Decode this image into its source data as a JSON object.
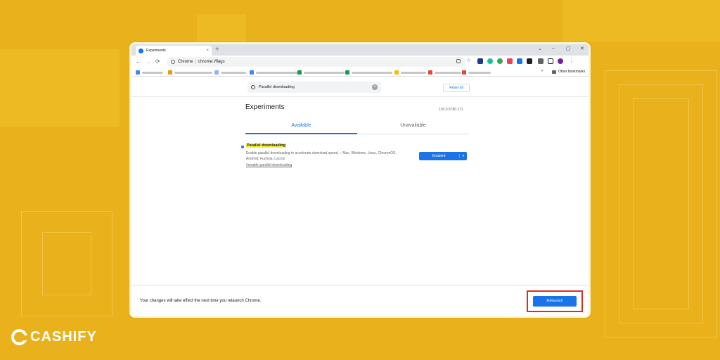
{
  "browser": {
    "tab_title": "Experiments",
    "tab_close": "×",
    "new_tab": "+",
    "window_controls": [
      "⌄",
      "–",
      "▢",
      "✕"
    ],
    "nav": [
      "←",
      "→",
      "⟳"
    ],
    "omnibox_site": "Chrome",
    "omnibox_sep": "|",
    "omnibox_url": "chrome://flags",
    "other_bookmarks": "Other bookmarks",
    "bookmarks_chevron": "»",
    "toolbar_icons": [
      "share-icon",
      "star-icon",
      "extension-icon",
      "grammarly-icon",
      "extension-icon",
      "pocket-icon",
      "extension-icon",
      "extension-icon",
      "puzzle-icon",
      "sidepanel-icon",
      "profile-icon",
      "menu-icon"
    ]
  },
  "flags_page": {
    "search_value": "Parallel downloading",
    "clear": "×",
    "reset_all": "Reset all",
    "title": "Experiments",
    "version": "135.0.5790.171",
    "tabs": [
      "Available",
      "Unavailable"
    ],
    "flag": {
      "name": "Parallel downloading",
      "description": "Enable parallel downloading to accelerate download speed. – Mac, Windows, Linux, ChromeOS, Android, Fuchsia, Lacros",
      "link": "#enable-parallel-downloading",
      "state": "Enabled",
      "caret": "▾"
    }
  },
  "footer": {
    "message": "Your changes will take effect the next time you relaunch Chrome.",
    "relaunch": "Relaunch"
  },
  "brand": {
    "logo_text": "CASHIFY"
  },
  "colors": {
    "background": "#e9b21c",
    "accent": "#1a73e8",
    "highlight": "#f7ef3f",
    "annotation": "#d93025"
  }
}
